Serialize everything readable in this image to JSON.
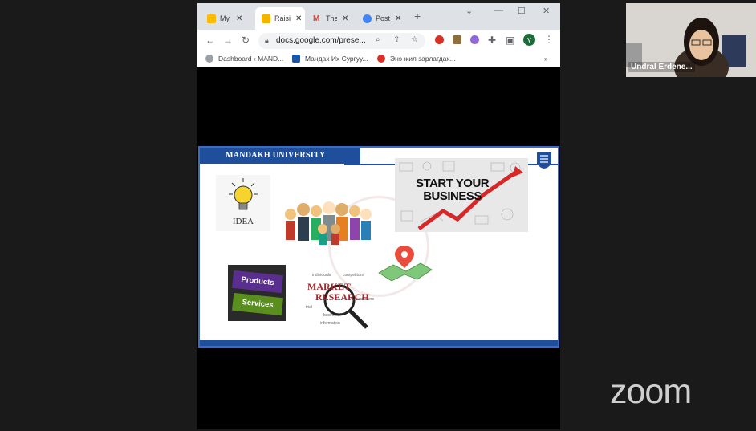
{
  "browser": {
    "tabs": [
      {
        "title": "My D",
        "favicon_color": "#fbbc04"
      },
      {
        "title": "Raisi",
        "favicon_color": "#f4b400"
      },
      {
        "title": "The i",
        "favicon_color": "#ea4335"
      },
      {
        "title": "Post",
        "favicon_color": "#4285f4"
      }
    ],
    "new_tab": "+",
    "url": "docs.google.com/prese...",
    "profile_initial": "y",
    "bookmarks": [
      {
        "label": "Dashboard ‹ MAND...",
        "icon_color": "#9aa0a6"
      },
      {
        "label": "Мандах Их Сургуу...",
        "icon_color": "#1a56a8"
      },
      {
        "label": "Энэ жил зарлагдах...",
        "icon_color": "#d93025"
      }
    ],
    "bookmarks_more": "»"
  },
  "slide": {
    "header": "MANDAKH UNIVERSITY",
    "idea_caption": "IDEA",
    "start_business_line1": "START YOUR",
    "start_business_line2": "BUSINESS",
    "products_label": "Products",
    "services_label": "Services",
    "market_line1": "MARKET",
    "market_line2": "RESEARCH"
  },
  "zoom": {
    "logo": "zoom",
    "participant_name": "Undral Erdene..."
  },
  "colors": {
    "slide_blue": "#1f4e9c",
    "tabbar": "#dee1e6"
  }
}
